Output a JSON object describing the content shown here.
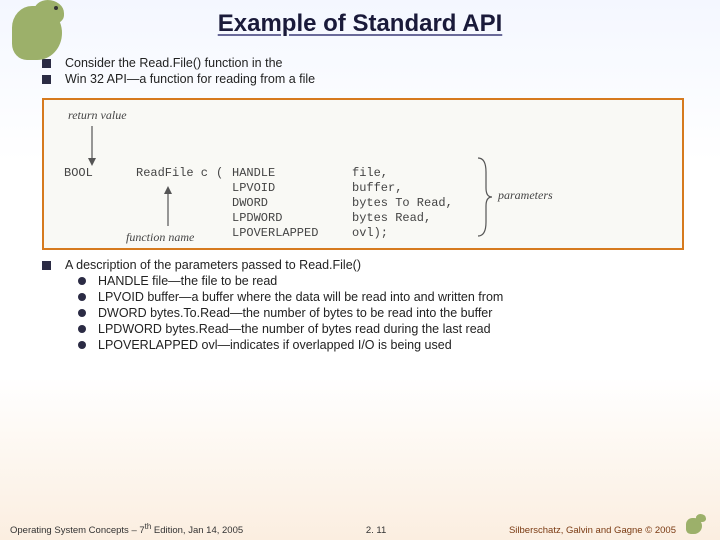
{
  "title": "Example of Standard API",
  "bullets": {
    "b1": "Consider the Read.File() function in the",
    "b2": "Win 32 API—a function for reading from a file",
    "b3": "A description of the parameters passed to Read.File()"
  },
  "sub_bullets": {
    "s1": "HANDLE file—the file to be read",
    "s2": "LPVOID buffer—a buffer where the data will be read into and written from",
    "s3": "DWORD bytes.To.Read—the number of bytes to be read into the buffer",
    "s4": "LPDWORD bytes.Read—the number of bytes read during the last read",
    "s5": "LPOVERLAPPED ovl—indicates if overlapped I/O is being used"
  },
  "diagram": {
    "return_value_label": "return value",
    "function_name_label": "function name",
    "parameters_label": "parameters",
    "return_type": "BOOL",
    "function_name": "ReadFile c",
    "open_paren": "(",
    "param_types": "HANDLE\nLPVOID\nDWORD\nLPDWORD\nLPOVERLAPPED",
    "param_names": "file,\nbuffer,\nbytes To Read,\nbytes Read,\novl);",
    "bracket_right": ""
  },
  "footer": {
    "left": "Operating System Concepts – 7",
    "left_sup": "th",
    "left_tail": " Edition, Jan 14, 2005",
    "center": "2. 11",
    "right_text": "Silberschatz, Galvin and Gagne ",
    "right_copy": "© 2005"
  }
}
